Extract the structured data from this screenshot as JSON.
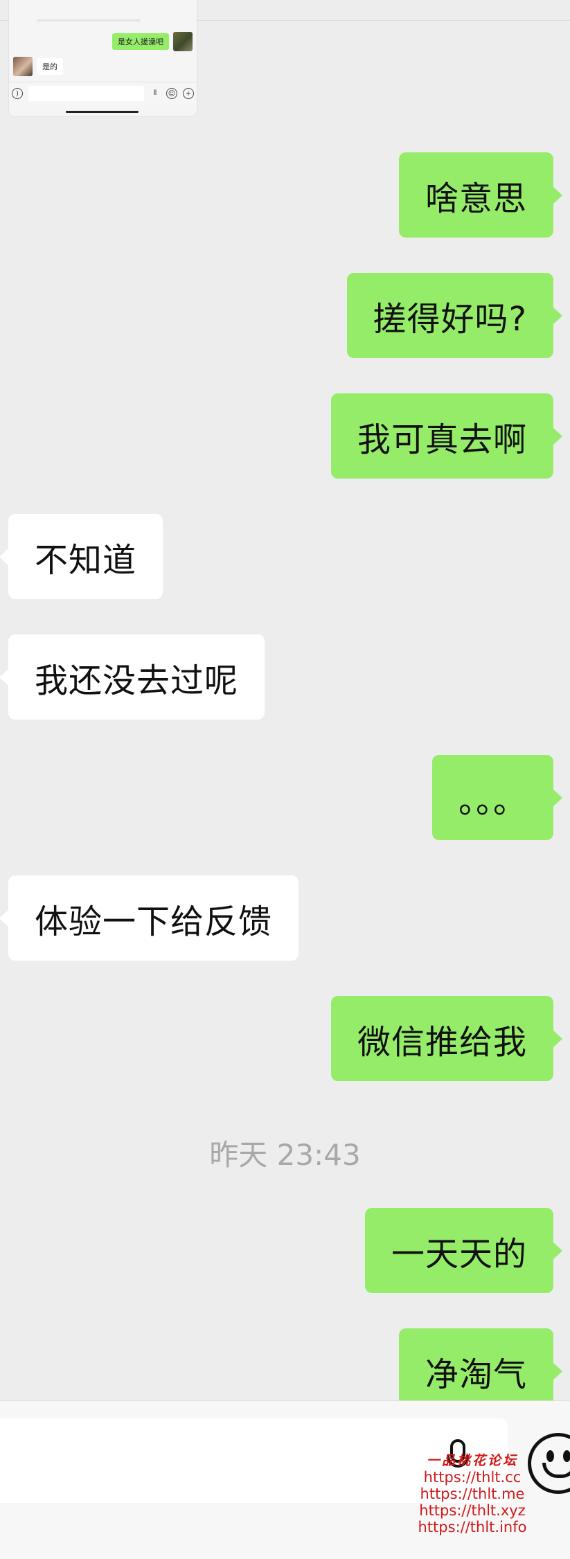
{
  "thumbnail": {
    "sent_text": "是女人搓澡吧",
    "received_text": "是的"
  },
  "messages": [
    {
      "side": "me",
      "text": "啥意思"
    },
    {
      "side": "me",
      "text": "搓得好吗?"
    },
    {
      "side": "me",
      "text": "我可真去啊"
    },
    {
      "side": "other",
      "text": "不知道"
    },
    {
      "side": "other",
      "text": "我还没去过呢"
    },
    {
      "side": "me",
      "text": "。。。"
    },
    {
      "side": "other",
      "text": "体验一下给反馈"
    },
    {
      "side": "me",
      "text": "微信推给我"
    },
    {
      "side": "me",
      "text": "一天天的"
    },
    {
      "side": "me",
      "text": "净淘气"
    }
  ],
  "timestamp": "昨天 23:43",
  "colors": {
    "background": "#ededed",
    "my_bubble": "#95ec69",
    "other_bubble": "#ffffff"
  },
  "icons": [
    "voice-icon",
    "mic-icon",
    "emoji-icon",
    "plus-icon"
  ],
  "watermark": {
    "title": "一品桃花论坛",
    "urls": [
      "https://thlt.cc",
      "https://thlt.me",
      "https://thlt.xyz",
      "https://thlt.info"
    ]
  }
}
